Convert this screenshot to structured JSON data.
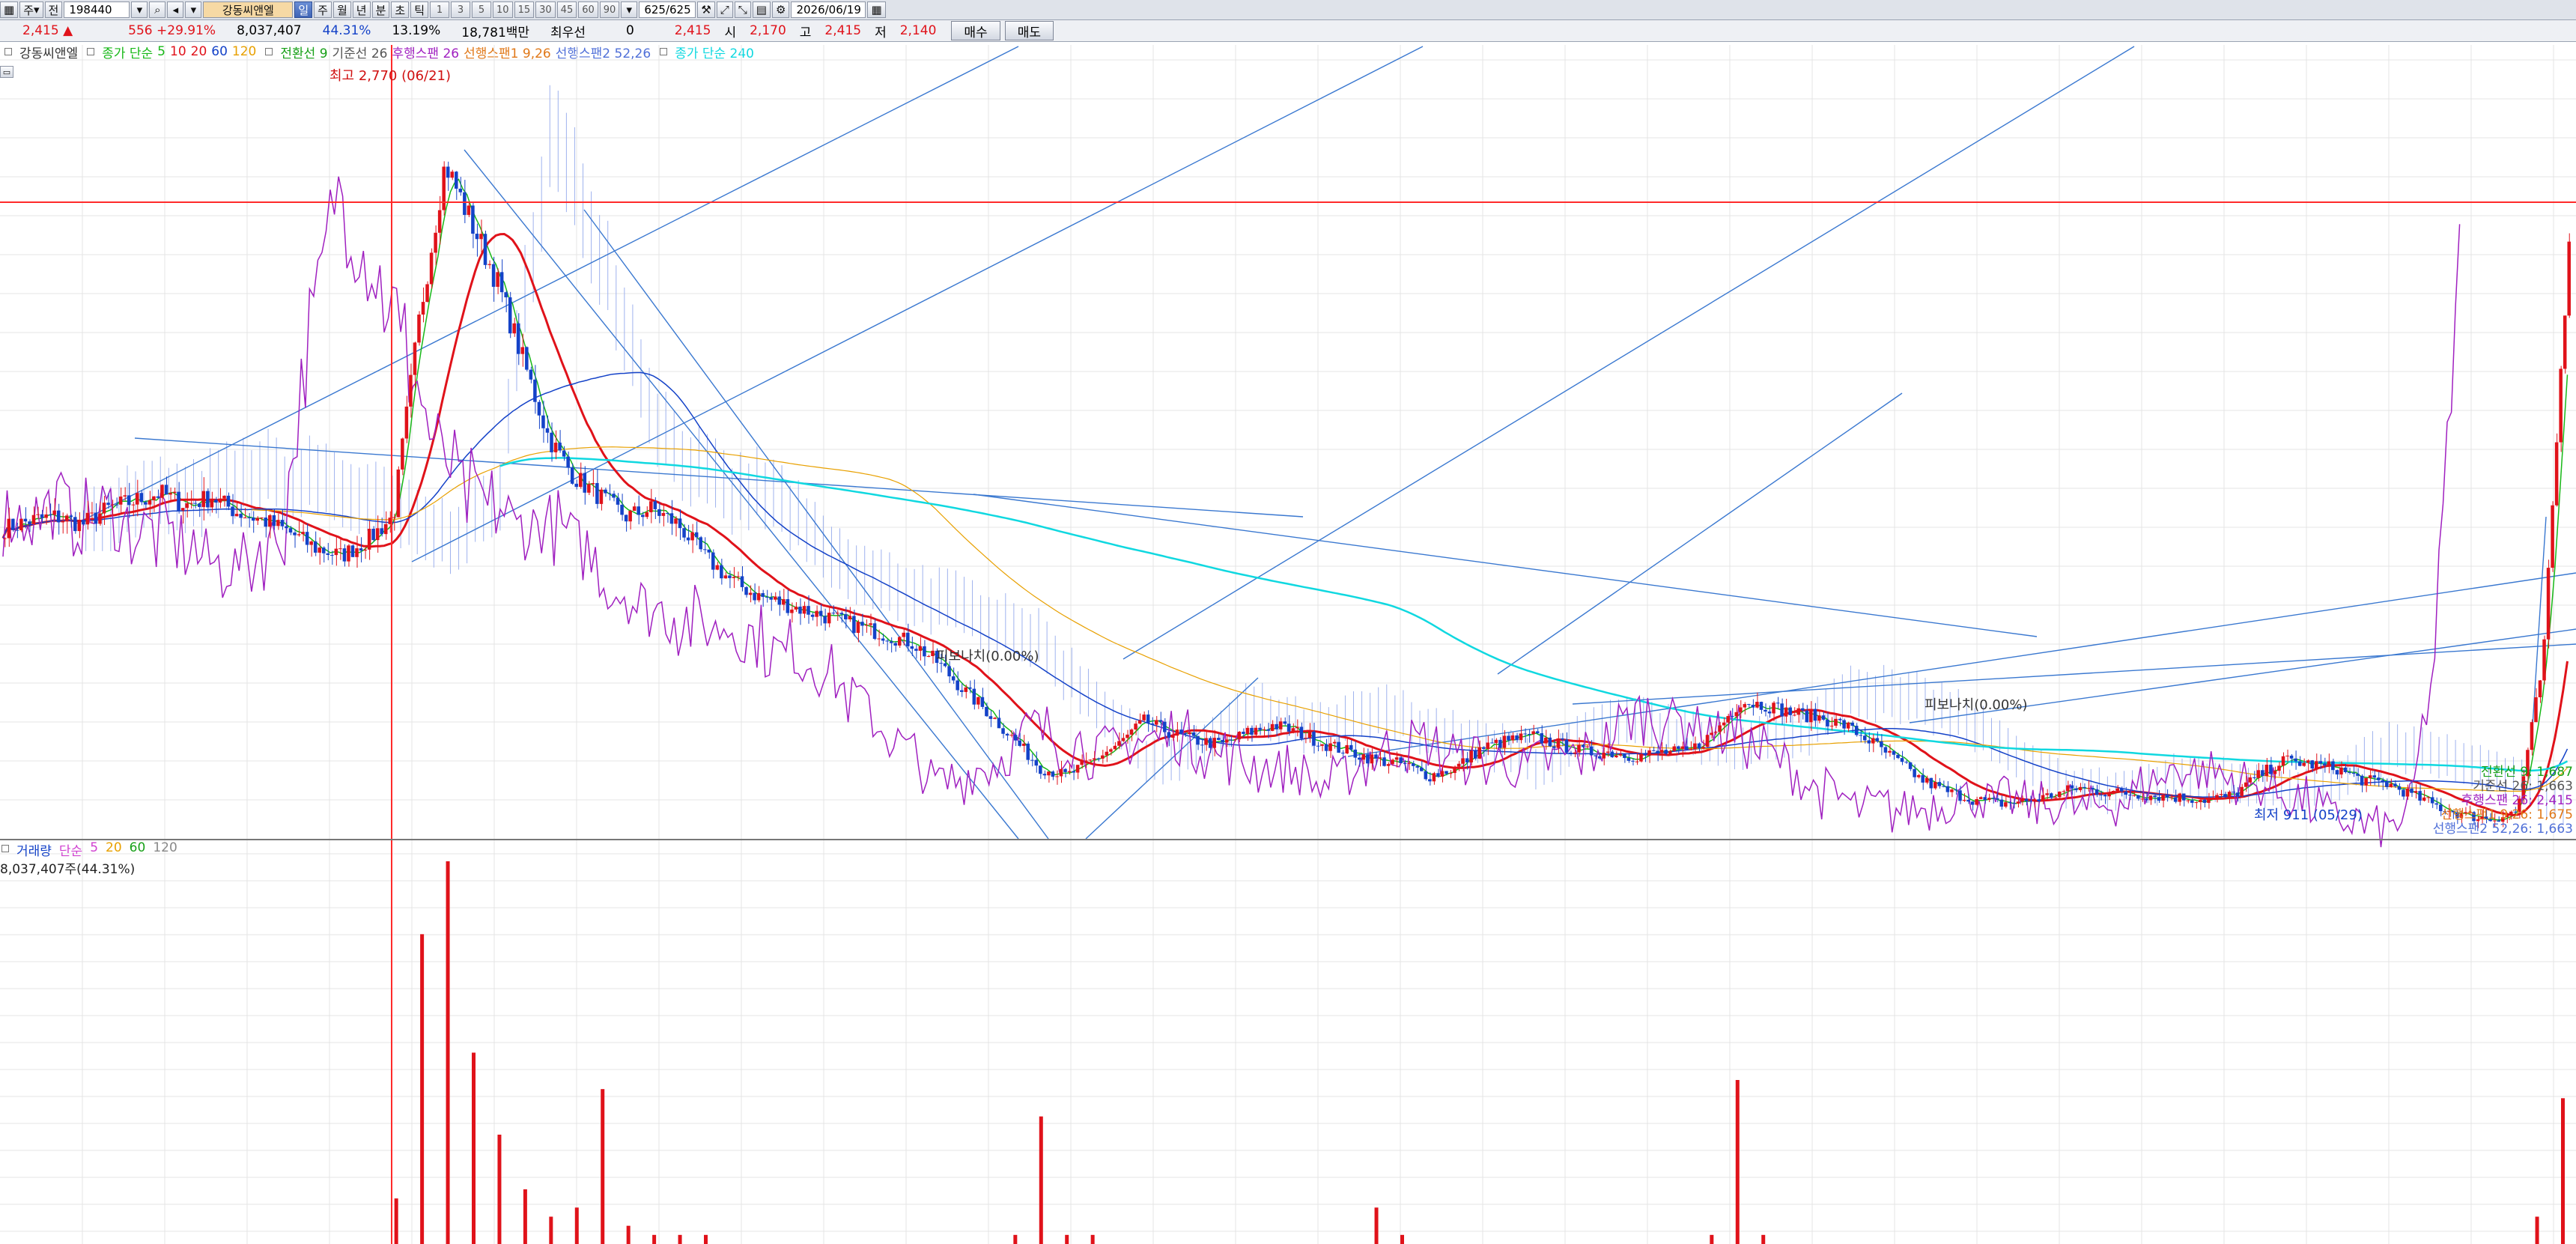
{
  "toolbar": {
    "dropdown_mode": "주",
    "button_jeon": "전",
    "stock_code": "198440",
    "stock_name": "강동씨앤엘",
    "periods": [
      "일",
      "주",
      "월",
      "년",
      "분",
      "초",
      "틱"
    ],
    "active_period": "일",
    "intervals": [
      "1",
      "3",
      "5",
      "10",
      "15",
      "30",
      "45",
      "60",
      "90"
    ],
    "count": "625/625",
    "date": "2026/06/19"
  },
  "quote": {
    "price": "2,415",
    "change": "556",
    "change_pct": "+29.91%",
    "volume": "8,037,407",
    "volume_ratio": "44.31%",
    "turnover": "13.19%",
    "amount": "18,781백만",
    "preferred_label": "최우선",
    "preferred_value": "0",
    "current": "2,415",
    "open_label": "시",
    "open": "2,170",
    "high_label": "고",
    "high": "2,415",
    "low_label": "저",
    "low": "2,140",
    "buy_label": "매수",
    "sell_label": "매도"
  },
  "legend": {
    "stock": "강동씨앤엘",
    "ma_label": "종가 단순",
    "ma_periods": [
      "5",
      "10",
      "20",
      "60",
      "120"
    ],
    "ma_colors": [
      "#18b818",
      "#e0121a",
      "#1442c8",
      "#18a018",
      "#e8a000"
    ],
    "conv": "전환선 9",
    "base": "기준선 26",
    "lag": "후행스팬 26",
    "span1": "선행스팬1 9,26",
    "span2": "선행스팬2 52,26",
    "ma240": "종가 단순 240"
  },
  "volume_legend": {
    "label": "거래량",
    "ma_label": "단순",
    "periods": [
      "5",
      "20",
      "60",
      "120"
    ],
    "colors": [
      "#d040d0",
      "#e8a000",
      "#18a018",
      "#888888"
    ],
    "sub": "8,037,407주(44.31%)"
  },
  "annotations": {
    "high": "최고 2,770 (06/21)",
    "low": "최저 911 (05/29)",
    "label_pct_1": "피보나치(0.00%)",
    "label_pct_2": "피보나치(0.00%)",
    "right_values": [
      {
        "text": "전환선 9: 1,687",
        "color": "#18a018"
      },
      {
        "text": "기준선 26: 1,663",
        "color": "#555555"
      },
      {
        "text": "후행스팬 26: 2,415",
        "color": "#a020c0"
      },
      {
        "text": "선행스팬1 9,26: 1,675",
        "color": "#e07818"
      },
      {
        "text": "선행스팬2 52,26: 1,663",
        "color": "#5070d8"
      }
    ]
  },
  "chart_data": {
    "type": "candlestick",
    "date_range": [
      "2021-06",
      "2026-06-19"
    ],
    "ylim": [
      880,
      2900
    ],
    "price_series": [
      1670,
      1690,
      1700,
      1680,
      1720,
      1740,
      1760,
      1730,
      1750,
      1710,
      1690,
      1660,
      1620,
      1600,
      1640,
      1700,
      2200,
      2600,
      2450,
      2300,
      2100,
      1900,
      1800,
      1750,
      1700,
      1720,
      1680,
      1600,
      1540,
      1500,
      1480,
      1460,
      1440,
      1420,
      1400,
      1380,
      1330,
      1260,
      1200,
      1130,
      1060,
      1040,
      1080,
      1120,
      1180,
      1150,
      1130,
      1120,
      1150,
      1170,
      1150,
      1120,
      1100,
      1080,
      1070,
      1040,
      1060,
      1110,
      1130,
      1140,
      1120,
      1100,
      1100,
      1090,
      1100,
      1100,
      1150,
      1230,
      1220,
      1200,
      1190,
      1170,
      1130,
      1080,
      1030,
      1000,
      980,
      970,
      975,
      990,
      1010,
      1000,
      995,
      990,
      985,
      980,
      990,
      1040,
      1080,
      1070,
      1060,
      1030,
      1020,
      990,
      960,
      940,
      930,
      950,
      1330,
      2415
    ],
    "volume_series": [
      0,
      0,
      0,
      0,
      0,
      0,
      0,
      0,
      0,
      0,
      0,
      0,
      0,
      0,
      0,
      0.5,
      3.4,
      4.2,
      2.1,
      1.2,
      0.6,
      0.3,
      0.4,
      1.7,
      0.2,
      0.1,
      0.1,
      0.1,
      0,
      0,
      0,
      0,
      0,
      0,
      0,
      0,
      0,
      0,
      0,
      0.1,
      1.4,
      0.1,
      0.1,
      0,
      0,
      0,
      0,
      0,
      0,
      0,
      0,
      0,
      0,
      0.4,
      0.1,
      0,
      0,
      0,
      0,
      0,
      0,
      0,
      0,
      0,
      0,
      0,
      0.1,
      1.8,
      0.1,
      0,
      0,
      0,
      0,
      0,
      0,
      0,
      0,
      0,
      0,
      0,
      0,
      0,
      0,
      0,
      0,
      0,
      0,
      0,
      0,
      0,
      0,
      0,
      0,
      0,
      0,
      0,
      0,
      0,
      0.3,
      1.6
    ],
    "volume_unit": "millions",
    "horizontal_line": 2760
  }
}
